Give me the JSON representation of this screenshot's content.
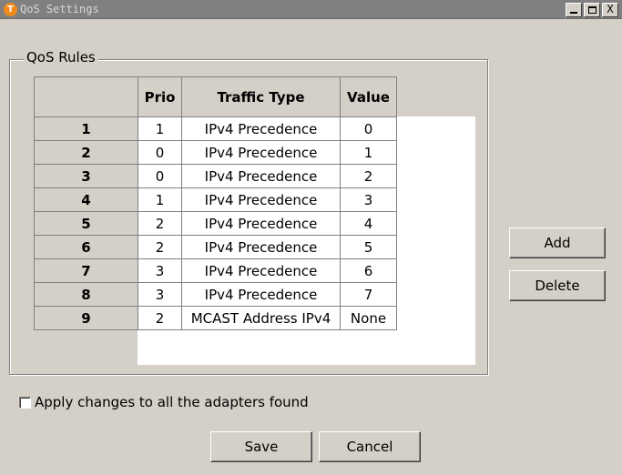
{
  "window": {
    "title": "QoS Settings",
    "app_icon_glyph": "T"
  },
  "titlebar_buttons": {
    "minimize": "_",
    "maximize": "□",
    "close": "X"
  },
  "group": {
    "label": "QoS Rules"
  },
  "table": {
    "columns": [
      "",
      "Prio",
      "Traffic Type",
      "Value"
    ],
    "rows": [
      {
        "id": "1",
        "prio": "1",
        "type": "IPv4 Precedence",
        "value": "0"
      },
      {
        "id": "2",
        "prio": "0",
        "type": "IPv4 Precedence",
        "value": "1"
      },
      {
        "id": "3",
        "prio": "0",
        "type": "IPv4 Precedence",
        "value": "2"
      },
      {
        "id": "4",
        "prio": "1",
        "type": "IPv4 Precedence",
        "value": "3"
      },
      {
        "id": "5",
        "prio": "2",
        "type": "IPv4 Precedence",
        "value": "4"
      },
      {
        "id": "6",
        "prio": "2",
        "type": "IPv4 Precedence",
        "value": "5"
      },
      {
        "id": "7",
        "prio": "3",
        "type": "IPv4 Precedence",
        "value": "6"
      },
      {
        "id": "8",
        "prio": "3",
        "type": "IPv4 Precedence",
        "value": "7"
      },
      {
        "id": "9",
        "prio": "2",
        "type": "MCAST Address IPv4",
        "value": "None"
      }
    ]
  },
  "buttons": {
    "add": "Add",
    "delete": "Delete",
    "save": "Save",
    "cancel": "Cancel"
  },
  "apply_all": {
    "label": "Apply changes to all the adapters found",
    "checked": false
  },
  "colors": {
    "titlebar": "#808080",
    "dialog": "#d4d0c8",
    "icon": "#f08a1c"
  }
}
